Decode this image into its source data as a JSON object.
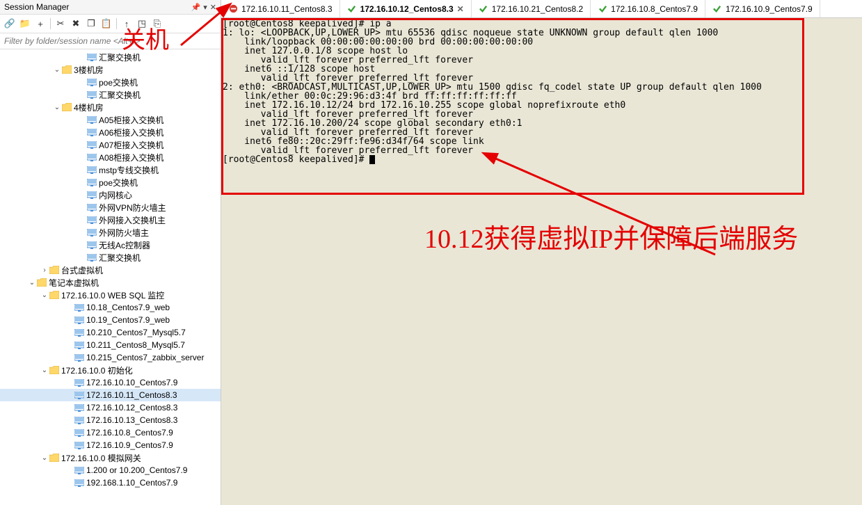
{
  "panel": {
    "title": "Session Manager",
    "filter_placeholder": "Filter by folder/session name <Alt+I>",
    "filter_kbd": "Alt+I"
  },
  "toolbar": {
    "link": "🔗",
    "new_folder": "📁",
    "new": "+",
    "cut": "✂",
    "delete": "✖",
    "copy": "❐",
    "paste": "📋",
    "up": "↑",
    "open": "◳",
    "export": "⎘"
  },
  "tree": [
    {
      "lvl": 6,
      "type": "host",
      "label": "汇聚交换机"
    },
    {
      "lvl": 4,
      "type": "folder",
      "label": "3楼机房",
      "exp": true
    },
    {
      "lvl": 6,
      "type": "host",
      "label": "poe交换机"
    },
    {
      "lvl": 6,
      "type": "host",
      "label": "汇聚交换机"
    },
    {
      "lvl": 4,
      "type": "folder",
      "label": "4楼机房",
      "exp": true
    },
    {
      "lvl": 6,
      "type": "host",
      "label": "A05柜接入交换机"
    },
    {
      "lvl": 6,
      "type": "host",
      "label": "A06柜接入交换机"
    },
    {
      "lvl": 6,
      "type": "host",
      "label": "A07柜接入交换机"
    },
    {
      "lvl": 6,
      "type": "host",
      "label": "A08柜接入交换机"
    },
    {
      "lvl": 6,
      "type": "host",
      "label": "mstp专线交换机"
    },
    {
      "lvl": 6,
      "type": "host",
      "label": "poe交换机"
    },
    {
      "lvl": 6,
      "type": "host",
      "label": "内网核心"
    },
    {
      "lvl": 6,
      "type": "host",
      "label": "外网VPN防火墙主"
    },
    {
      "lvl": 6,
      "type": "host",
      "label": "外网接入交换机主"
    },
    {
      "lvl": 6,
      "type": "host",
      "label": "外网防火墙主"
    },
    {
      "lvl": 6,
      "type": "host",
      "label": "无线Ac控制器"
    },
    {
      "lvl": 6,
      "type": "host",
      "label": "汇聚交换机"
    },
    {
      "lvl": 3,
      "type": "folder",
      "label": "台式虚拟机",
      "exp": false
    },
    {
      "lvl": 2,
      "type": "folder",
      "label": "笔记本虚拟机",
      "exp": true
    },
    {
      "lvl": 3,
      "type": "folder",
      "label": "172.16.10.0 WEB SQL 监控",
      "exp": true
    },
    {
      "lvl": 5,
      "type": "host",
      "label": "10.18_Centos7.9_web"
    },
    {
      "lvl": 5,
      "type": "host",
      "label": "10.19_Centos7.9_web"
    },
    {
      "lvl": 5,
      "type": "host",
      "label": "10.210_Centos7_Mysql5.7"
    },
    {
      "lvl": 5,
      "type": "host",
      "label": "10.211_Centos8_Mysql5.7"
    },
    {
      "lvl": 5,
      "type": "host",
      "label": "10.215_Centos7_zabbix_server"
    },
    {
      "lvl": 3,
      "type": "folder",
      "label": "172.16.10.0 初始化",
      "exp": true
    },
    {
      "lvl": 5,
      "type": "host",
      "label": "172.16.10.10_Centos7.9"
    },
    {
      "lvl": 5,
      "type": "host",
      "label": "172.16.10.11_Centos8.3",
      "sel": true
    },
    {
      "lvl": 5,
      "type": "host",
      "label": "172.16.10.12_Centos8.3"
    },
    {
      "lvl": 5,
      "type": "host",
      "label": "172.16.10.13_Centos8.3"
    },
    {
      "lvl": 5,
      "type": "host",
      "label": "172.16.10.8_Centos7.9"
    },
    {
      "lvl": 5,
      "type": "host",
      "label": "172.16.10.9_Centos7.9"
    },
    {
      "lvl": 3,
      "type": "folder",
      "label": "172.16.10.0 模拟网关",
      "exp": true
    },
    {
      "lvl": 5,
      "type": "host",
      "label": "1.200 or 10.200_Centos7.9"
    },
    {
      "lvl": 5,
      "type": "host",
      "label": "192.168.1.10_Centos7.9"
    }
  ],
  "tabs": [
    {
      "label": "172.16.10.11_Centos8.3",
      "status": "closed",
      "active": false,
      "closable": false
    },
    {
      "label": "172.16.10.12_Centos8.3",
      "status": "open",
      "active": true,
      "closable": true
    },
    {
      "label": "172.16.10.21_Centos8.2",
      "status": "open",
      "active": false,
      "closable": false
    },
    {
      "label": "172.16.10.8_Centos7.9",
      "status": "open",
      "active": false,
      "closable": false
    },
    {
      "label": "172.16.10.9_Centos7.9",
      "status": "open",
      "active": false,
      "closable": false
    }
  ],
  "terminal": "[root@Centos8 keepalived]# ip a\n1: lo: <LOOPBACK,UP,LOWER_UP> mtu 65536 qdisc noqueue state UNKNOWN group default qlen 1000\n    link/loopback 00:00:00:00:00:00 brd 00:00:00:00:00:00\n    inet 127.0.0.1/8 scope host lo\n       valid_lft forever preferred_lft forever\n    inet6 ::1/128 scope host\n       valid_lft forever preferred_lft forever\n2: eth0: <BROADCAST,MULTICAST,UP,LOWER_UP> mtu 1500 qdisc fq_codel state UP group default qlen 1000\n    link/ether 00:0c:29:96:d3:4f brd ff:ff:ff:ff:ff:ff\n    inet 172.16.10.12/24 brd 172.16.10.255 scope global noprefixroute eth0\n       valid_lft forever preferred_lft forever\n    inet 172.16.10.200/24 scope global secondary eth0:1\n       valid_lft forever preferred_lft forever\n    inet6 fe80::20c:29ff:fe96:d34f/64 scope link\n       valid_lft forever preferred_lft forever\n[root@Centos8 keepalived]# ",
  "annotations": {
    "a1": "关机",
    "a2": "10.12获得虚拟IP并保障后端服务"
  }
}
